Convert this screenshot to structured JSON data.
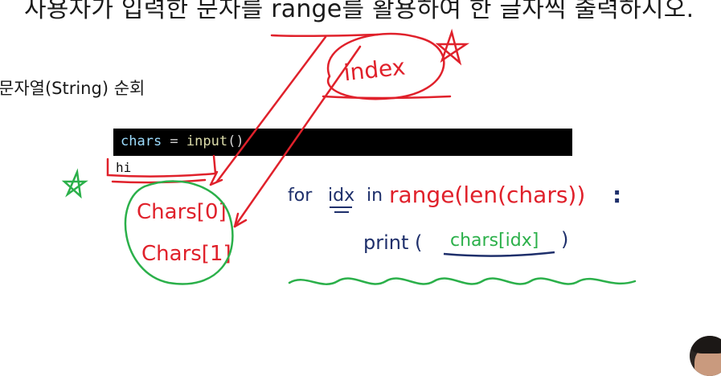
{
  "slide": {
    "headline": "사용자가 입력한 문자를 range를 활용하여 한 글자씩 출력하시오.",
    "section_heading": "문자열(String) 순회"
  },
  "code": {
    "input_line": {
      "var": "chars",
      "op": " = ",
      "fn": "input",
      "paren": "()"
    },
    "output_value": "hi"
  },
  "annotations": {
    "index_word": "index",
    "first_element": "Chars[0]",
    "second_element": "Chars[1]",
    "loop_for": "for",
    "loop_var": "idx",
    "loop_in": "in",
    "loop_iter": "range(len(chars))",
    "loop_colon": ":",
    "print_open": "print (",
    "print_arg": "chars[idx]",
    "print_close": ")"
  },
  "colors": {
    "red_ink": "#e0212b",
    "green_ink": "#2bb04a",
    "navy_ink": "#1e2f6b",
    "code_bg": "#000000"
  }
}
